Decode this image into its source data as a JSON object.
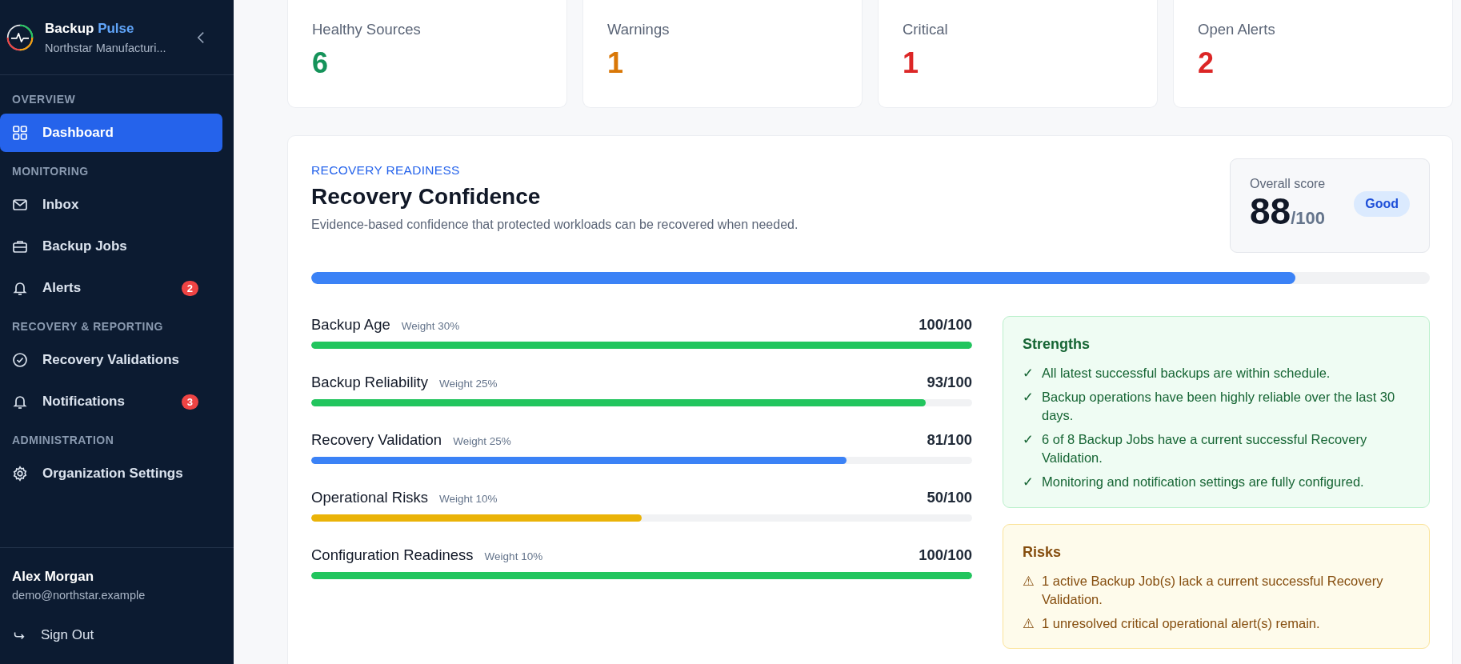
{
  "brand": {
    "name": "Backup",
    "accent": "Pulse",
    "org": "Northstar Manufacturi..."
  },
  "nav": [
    {
      "title": "OVERVIEW",
      "items": [
        {
          "label": "Dashboard",
          "kind": "grid",
          "selected": true
        }
      ]
    },
    {
      "title": "MONITORING",
      "items": [
        {
          "label": "Inbox",
          "kind": "mail",
          "selected": false
        },
        {
          "label": "Backup Jobs",
          "kind": "briefcase",
          "selected": false
        },
        {
          "label": "Alerts",
          "kind": "bell",
          "selected": false,
          "badge": "2"
        }
      ]
    },
    {
      "title": "RECOVERY & REPORTING",
      "items": [
        {
          "label": "Recovery Validations",
          "kind": "check",
          "selected": false
        },
        {
          "label": "Notifications",
          "kind": "bell",
          "selected": false,
          "badge": "3"
        }
      ]
    },
    {
      "title": "ADMINISTRATION",
      "items": [
        {
          "label": "Organization Settings",
          "kind": "gear",
          "selected": false
        }
      ]
    }
  ],
  "user": {
    "name": "Alex Morgan",
    "email": "demo@northstar.example"
  },
  "sign_out": "Sign Out",
  "stats": [
    {
      "label": "Healthy Sources",
      "value": "6",
      "color": "#15935a"
    },
    {
      "label": "Warnings",
      "value": "1",
      "color": "#d97706"
    },
    {
      "label": "Critical",
      "value": "1",
      "color": "#dc2626"
    },
    {
      "label": "Open Alerts",
      "value": "2",
      "color": "#dc2626"
    }
  ],
  "readiness": {
    "eyebrow": "RECOVERY READINESS",
    "title": "Recovery Confidence",
    "description": "Evidence-based confidence that protected workloads can be recovered when needed.",
    "score": {
      "label": "Overall score",
      "value": "88",
      "max": "/100",
      "badge": "Good"
    },
    "level": 0.88,
    "factors": [
      {
        "name": "Backup Age",
        "weight": "Weight 30%",
        "score": "100/100",
        "level": 1,
        "color": "#22c55e"
      },
      {
        "name": "Backup Reliability",
        "weight": "Weight 25%",
        "score": "93/100",
        "level": 0.93,
        "color": "#22c55e"
      },
      {
        "name": "Recovery Validation",
        "weight": "Weight 25%",
        "score": "81/100",
        "level": 0.81,
        "color": "#3b82f6"
      },
      {
        "name": "Operational Risks",
        "weight": "Weight 10%",
        "score": "50/100",
        "level": 0.5,
        "color": "#eab308"
      },
      {
        "name": "Configuration Readiness",
        "weight": "Weight 10%",
        "score": "100/100",
        "level": 1,
        "color": "#22c55e"
      }
    ],
    "strengths": {
      "title": "Strengths",
      "mark": "✓",
      "items": [
        "All latest successful backups are within schedule.",
        "Backup operations have been highly reliable over the last 30 days.",
        "6 of 8 Backup Jobs have a current successful Recovery Validation.",
        "Monitoring and notification settings are fully configured."
      ]
    },
    "risks": {
      "title": "Risks",
      "mark": "⚠",
      "items": [
        "1 active Backup Job(s) lack a current successful Recovery Validation.",
        "1 unresolved critical operational alert(s) remain."
      ]
    }
  }
}
